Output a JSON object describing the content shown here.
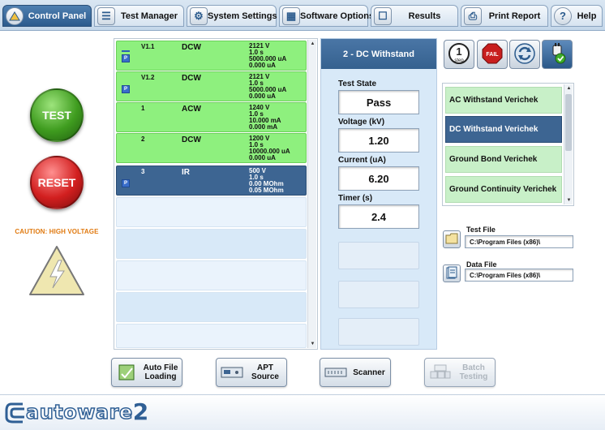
{
  "tabs": [
    {
      "label": "Control Panel",
      "icon": "control-panel-icon",
      "active": true
    },
    {
      "label": "Test Manager",
      "icon": "test-manager-icon"
    },
    {
      "label": "System Settings",
      "icon": "system-settings-icon"
    },
    {
      "label": "Software Options",
      "icon": "software-options-icon"
    },
    {
      "label": "Results",
      "icon": "results-icon"
    },
    {
      "label": "Print Report",
      "icon": "print-report-icon"
    },
    {
      "label": "Help",
      "icon": "help-icon"
    }
  ],
  "left": {
    "test_label": "TEST",
    "reset_label": "RESET",
    "caution": "CAUTION: HIGH VOLTAGE"
  },
  "steps": [
    {
      "id": "V1.1",
      "name": "DCW",
      "params": [
        "2121 V",
        "1.0 s",
        "5000.000 uA",
        "0.000 uA"
      ],
      "status": "pass",
      "badge": "P",
      "mini_bar": true
    },
    {
      "id": "V1.2",
      "name": "DCW",
      "params": [
        "2121 V",
        "1.0 s",
        "5000.000 uA",
        "0.000 uA"
      ],
      "status": "pass",
      "badge": "P"
    },
    {
      "id": "1",
      "name": "ACW",
      "params": [
        "1240 V",
        "1.0 s",
        "10.000 mA",
        "0.000 mA"
      ],
      "status": "pass"
    },
    {
      "id": "2",
      "name": "DCW",
      "params": [
        "1200 V",
        "1.0 s",
        "10000.000 uA",
        "0.000 uA"
      ],
      "status": "pass"
    },
    {
      "id": "3",
      "name": "IR",
      "params": [
        "500 V",
        "1.0 s",
        "0.00 MOhm",
        "0.05 MOhm"
      ],
      "status": "selected",
      "badge": "P"
    }
  ],
  "mid": {
    "title": "2 - DC Withstand",
    "test_state_label": "Test State",
    "test_state": "Pass",
    "voltage_label": "Voltage (kV)",
    "voltage": "1.20",
    "current_label": "Current (uA)",
    "current": "6.20",
    "timer_label": "Timer (s)",
    "timer": "2.4"
  },
  "right_icons": [
    {
      "name": "single-step-icon",
      "label": "1 step"
    },
    {
      "name": "fail-icon",
      "label": "FAIL"
    },
    {
      "name": "loop-icon"
    },
    {
      "name": "verify-plug-icon",
      "active": true
    }
  ],
  "verichecks": [
    {
      "label": "AC Withstand Verichek"
    },
    {
      "label": "DC Withstand Verichek",
      "selected": true
    },
    {
      "label": "Ground Bond Verichek"
    },
    {
      "label": "Ground Continuity Verichek"
    }
  ],
  "files": {
    "test_file_label": "Test File",
    "test_file_path": "C:\\Program Files (x86)\\",
    "data_file_label": "Data File",
    "data_file_path": "C:\\Program Files (x86)\\"
  },
  "bottom_buttons": [
    {
      "line1": "Auto File",
      "line2": "Loading"
    },
    {
      "line1": "APT",
      "line2": "Source"
    },
    {
      "line1": "Scanner",
      "line2": ""
    },
    {
      "line1": "Batch",
      "line2": "Testing",
      "disabled": true
    }
  ],
  "footer": {
    "logo_text": "autoware",
    "logo_version": "2"
  },
  "colors": {
    "accent": "#3d6592",
    "pass": "#8ef07e",
    "test": "#3f9c1f",
    "reset": "#d21f1f",
    "caution": "#e07a10"
  }
}
